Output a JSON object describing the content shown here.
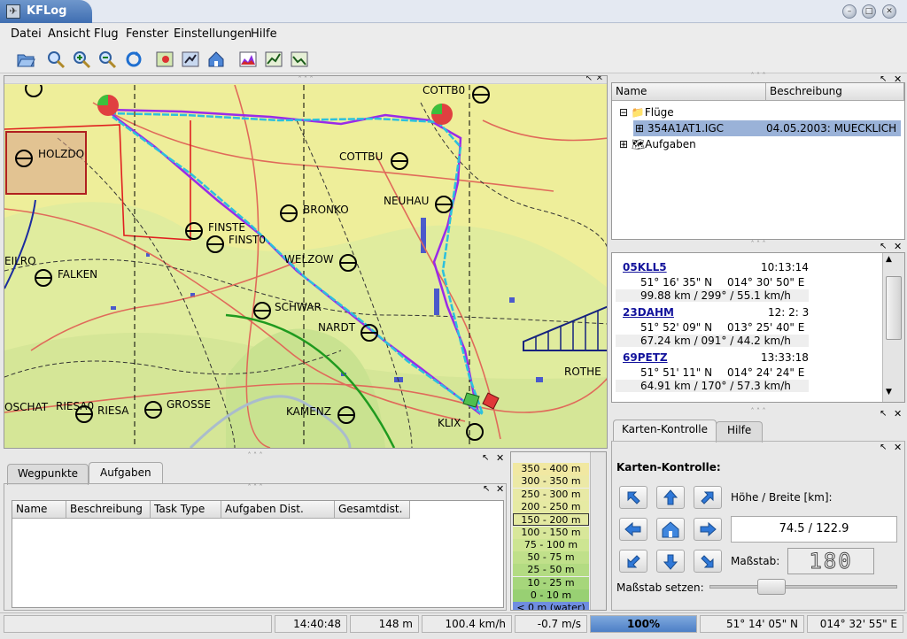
{
  "window": {
    "title": "KFLog",
    "icon": "kflog-app-icon",
    "controls": [
      "minimize-icon",
      "maximize-icon",
      "close-icon"
    ]
  },
  "menu": [
    "Datei",
    "Ansicht",
    "Flug",
    "Fenster",
    "Einstellungen",
    "Hilfe"
  ],
  "toolbar": [
    "open-folder-icon",
    "zoom-icon",
    "zoom-in-icon",
    "zoom-out-icon",
    "redraw-icon",
    "map-edit-icon",
    "flight-animation-icon",
    "home-icon",
    "profile-chart-icon",
    "step-prev-icon",
    "step-next-icon"
  ],
  "map": {
    "labels": [
      "HOLZDO",
      "COTTB0",
      "COTTBU",
      "NEUHAU",
      "BRONKO",
      "FINSTE",
      "FINST0",
      "WELZOW",
      "FALKEN",
      "EILRO",
      "SCHWAR",
      "NARDT",
      "OSCHAT",
      "RIESA0",
      "RIESA",
      "GROSSE",
      "KAMENZ",
      "KLIX",
      "ROTHE"
    ]
  },
  "tree": {
    "columns": [
      "Name",
      "Beschreibung"
    ],
    "root": "Flüge",
    "flight": {
      "name": "354A1AT1.IGC",
      "desc": "04.05.2003: MUECKLICH"
    },
    "tasks": "Aufgaben"
  },
  "waypoints": [
    {
      "name": "05KLL5",
      "time": "10:13:14",
      "lat": "51° 16' 35\" N",
      "lon": "014° 30' 50\" E",
      "leg": "99.88 km / 299° / 55.1 km/h"
    },
    {
      "name": "23DAHM",
      "time": "12: 2: 3",
      "lat": "51° 52' 09\" N",
      "lon": "013° 25' 40\" E",
      "leg": "67.24 km / 091° / 44.2 km/h"
    },
    {
      "name": "69PETZ",
      "time": "13:33:18",
      "lat": "51° 51' 11\" N",
      "lon": "014° 24' 24\" E",
      "leg": "64.91 km / 170° / 57.3 km/h"
    }
  ],
  "mapcontrol": {
    "tabs": [
      "Karten-Kontrolle",
      "Hilfe"
    ],
    "heading": "Karten-Kontrolle:",
    "size_label": "Höhe / Breite [km]:",
    "size_value": "74.5 / 122.9",
    "scale_label": "Maßstab:",
    "scale_value": "180",
    "scale_set_label": "Maßstab setzen:",
    "scale_slider_fraction": 0.3
  },
  "bottom": {
    "tabs": [
      "Wegpunkte",
      "Aufgaben"
    ],
    "columns": [
      "Name",
      "Beschreibung",
      "Task Type",
      "Aufgaben Dist.",
      "Gesamtdist."
    ]
  },
  "legend": [
    {
      "label": "350 - 400 m",
      "color": "#f1e8a2"
    },
    {
      "label": "300 - 350 m",
      "color": "#ece9a6"
    },
    {
      "label": "250 - 300 m",
      "color": "#e8e9a5"
    },
    {
      "label": "200 - 250 m",
      "color": "#e6eaa3"
    },
    {
      "label": "150 - 200 m",
      "color": "#e3e9a1"
    },
    {
      "label": "100 - 150 m",
      "color": "#d8e79a"
    },
    {
      "label": "75 - 100 m",
      "color": "#cde592"
    },
    {
      "label": "50 - 75 m",
      "color": "#c0e08a"
    },
    {
      "label": "25 - 50 m",
      "color": "#b3db82"
    },
    {
      "label": "10 - 25 m",
      "color": "#a6d67b"
    },
    {
      "label": "0 - 10 m",
      "color": "#98d073"
    },
    {
      "label": "< 0 m (water)",
      "color": "#6f8de0"
    }
  ],
  "status": {
    "time": "14:40:48",
    "altitude": "148 m",
    "speed": "100.4 km/h",
    "vario": "-0.7 m/s",
    "progress": "100%",
    "lat": "51° 14' 05\" N",
    "lon": "014° 32' 55\" E"
  }
}
